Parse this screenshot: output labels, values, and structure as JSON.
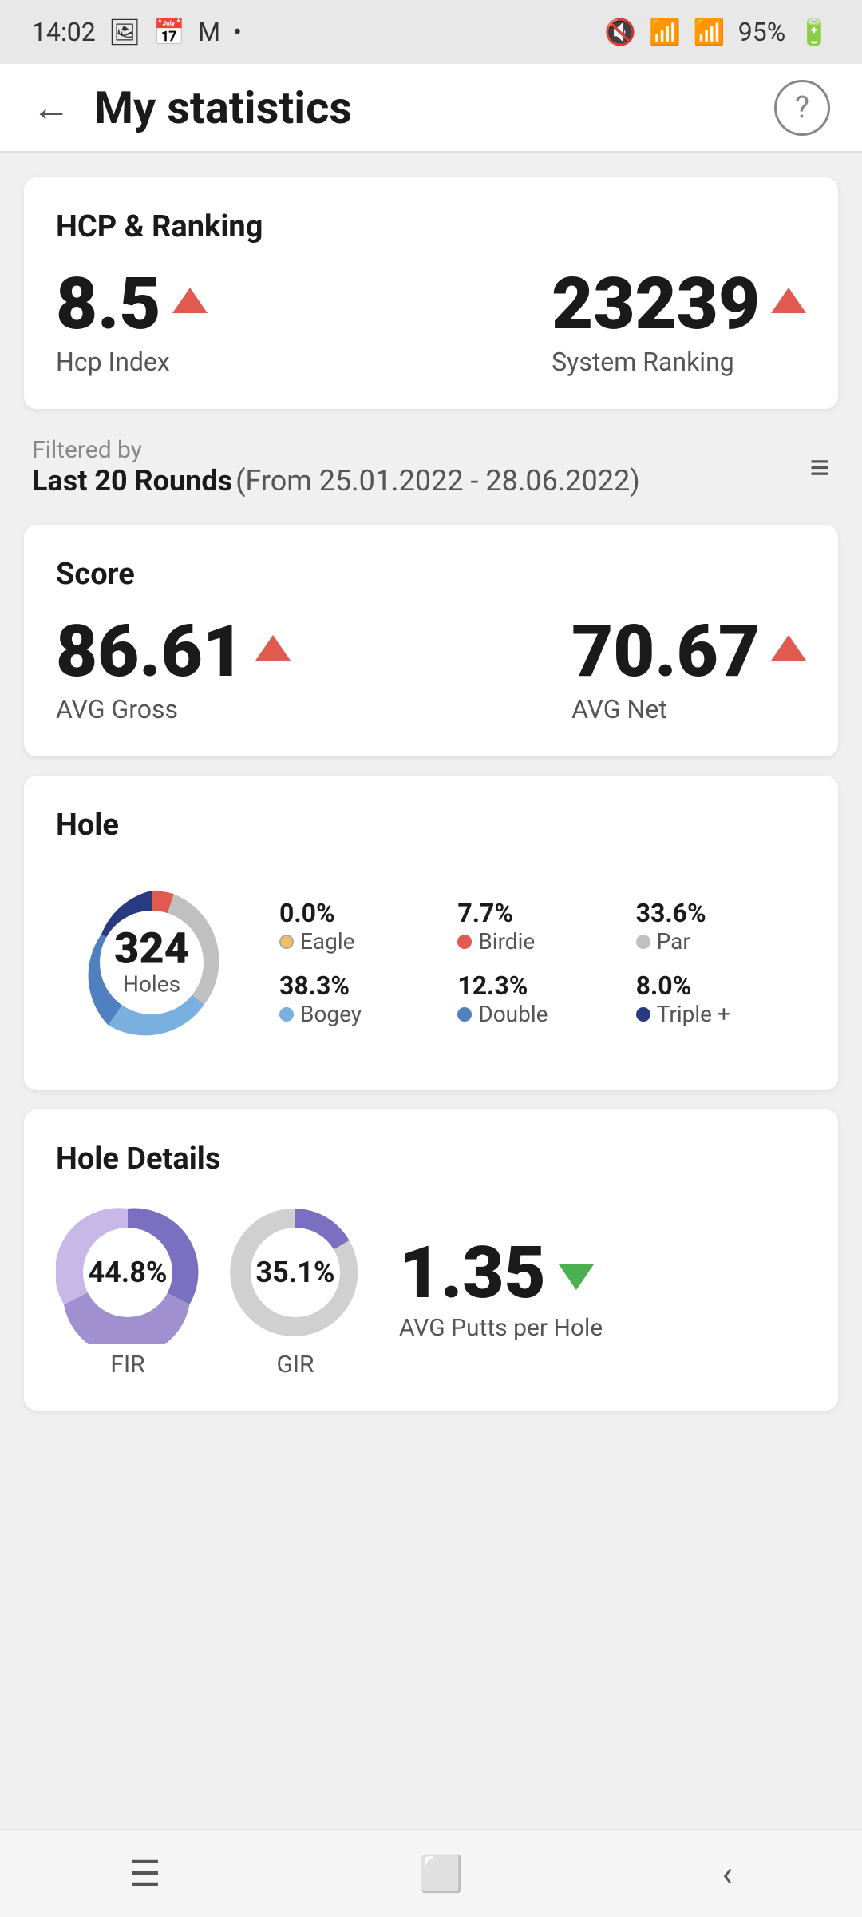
{
  "statusBar": {
    "time": "14:02",
    "battery": "95%"
  },
  "header": {
    "backLabel": "←",
    "title": "My statistics",
    "helpLabel": "?"
  },
  "hcpCard": {
    "title": "HCP & Ranking",
    "hcpValue": "8.5",
    "hcpLabel": "Hcp Index",
    "rankingValue": "23239",
    "rankingLabel": "System Ranking"
  },
  "filter": {
    "filteredByLabel": "Filtered by",
    "filterValue": "Last 20 Rounds",
    "filterRange": "(From 25.01.2022 - 28.06.2022)"
  },
  "scoreCard": {
    "title": "Score",
    "avgGrossValue": "86.61",
    "avgGrossLabel": "AVG Gross",
    "avgNetValue": "70.67",
    "avgNetLabel": "AVG Net"
  },
  "holeCard": {
    "title": "Hole",
    "holesCount": "324",
    "holesLabel": "Holes",
    "legend": [
      {
        "value": "0.0%",
        "label": "Eagle",
        "color": "#f0c060",
        "empty": true
      },
      {
        "value": "7.7%",
        "label": "Birdie",
        "color": "#e05a50"
      },
      {
        "value": "33.6%",
        "label": "Par",
        "color": "#c0c0c0"
      },
      {
        "value": "38.3%",
        "label": "Bogey",
        "color": "#7ab0e0"
      },
      {
        "value": "12.3%",
        "label": "Double",
        "color": "#5080c0"
      },
      {
        "value": "8.0%",
        "label": "Triple +",
        "color": "#2a3a80"
      }
    ]
  },
  "holeDetailsCard": {
    "title": "Hole Details",
    "firValue": "44.8%",
    "firLabel": "FIR",
    "girValue": "35.1%",
    "girLabel": "GIR",
    "avgPuttsValue": "1.35",
    "avgPuttsLabel": "AVG Putts per Hole"
  }
}
